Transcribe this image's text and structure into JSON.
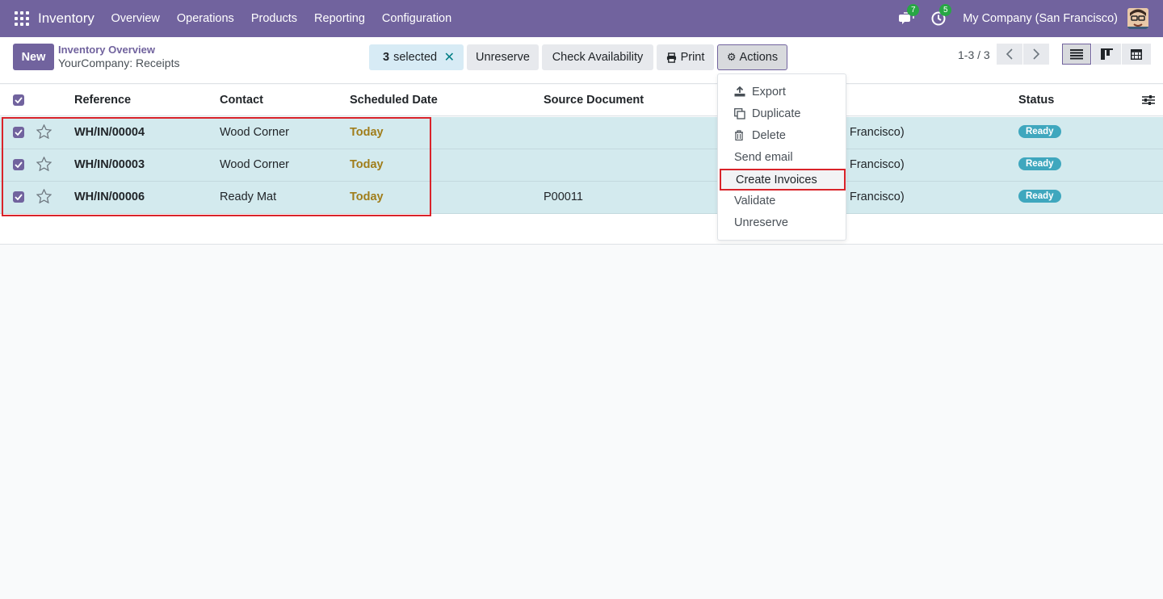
{
  "navbar": {
    "app_name": "Inventory",
    "menu": [
      "Overview",
      "Operations",
      "Products",
      "Reporting",
      "Configuration"
    ],
    "messages_count": "7",
    "activities_count": "5",
    "company": "My Company (San Francisco)"
  },
  "control": {
    "new_label": "New",
    "breadcrumb_parent": "Inventory Overview",
    "breadcrumb_current": "YourCompany: Receipts",
    "selected_count": "3",
    "selected_label": "selected",
    "unreserve_label": "Unreserve",
    "check_availability_label": "Check Availability",
    "print_label": "Print",
    "actions_label": "Actions",
    "pager": "1-3 / 3"
  },
  "table": {
    "headers": {
      "reference": "Reference",
      "contact": "Contact",
      "scheduled_date": "Scheduled Date",
      "source_document": "Source Document",
      "status": "Status"
    },
    "rows": [
      {
        "reference": "WH/IN/00004",
        "contact": "Wood Corner",
        "date": "Today",
        "source": "",
        "company": "Francisco)",
        "status": "Ready"
      },
      {
        "reference": "WH/IN/00003",
        "contact": "Wood Corner",
        "date": "Today",
        "source": "",
        "company": "Francisco)",
        "status": "Ready"
      },
      {
        "reference": "WH/IN/00006",
        "contact": "Ready Mat",
        "date": "Today",
        "source": "P00011",
        "company": "Francisco)",
        "status": "Ready"
      }
    ]
  },
  "actions_menu": {
    "export": "Export",
    "duplicate": "Duplicate",
    "delete": "Delete",
    "send_email": "Send email",
    "create_invoices": "Create Invoices",
    "validate": "Validate",
    "unreserve": "Unreserve"
  },
  "colors": {
    "brand": "#71639e",
    "selected_row": "#d3eaee",
    "status_ready": "#3fa7be",
    "today": "#a07d1a",
    "highlight": "#d9232a"
  }
}
